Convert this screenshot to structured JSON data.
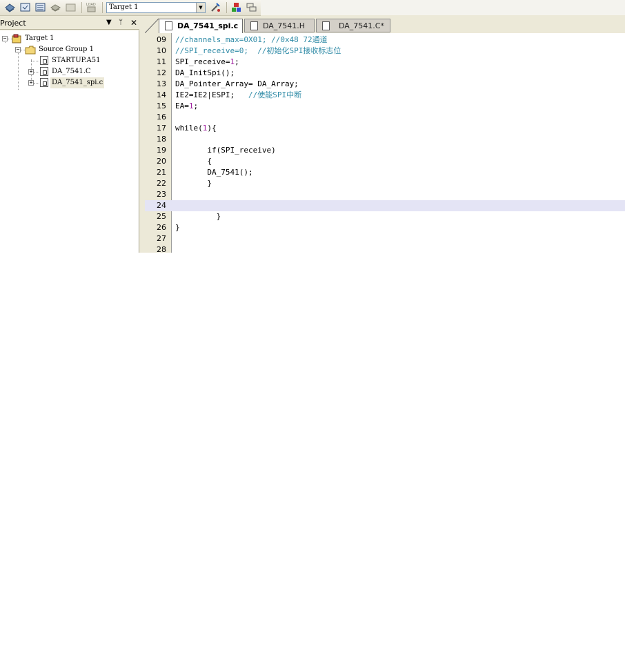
{
  "toolbar": {
    "target_value": "Target 1",
    "icons": [
      "build-icon",
      "translate-icon",
      "rebuild-icon",
      "batch-build-icon",
      "stop-build-icon",
      "load-icon",
      "target-options-icon",
      "manage-components-icon",
      "select-packs-icon"
    ]
  },
  "project_panel": {
    "title": "Project",
    "tree": {
      "root": "Target 1",
      "group": "Source Group 1",
      "files": [
        "STARTUP.A51",
        "DA_7541.C",
        "DA_7541_spi.c"
      ]
    }
  },
  "tabs": [
    {
      "label": "DA_7541_spi.c",
      "active": true
    },
    {
      "label": "DA_7541.H",
      "active": false
    },
    {
      "label": "DA_7541.C*",
      "active": false
    }
  ],
  "editor": {
    "highlighted_line": "24",
    "lines": [
      {
        "n": "09",
        "parts": [
          {
            "t": "//channels_max=0X01; //0x48 72通道",
            "c": "cmt"
          }
        ]
      },
      {
        "n": "10",
        "parts": [
          {
            "t": "//SPI_receive=0;  //初始化SPI接收标志位",
            "c": "cmt"
          }
        ]
      },
      {
        "n": "11",
        "parts": [
          {
            "t": "SPI_receive=",
            "c": ""
          },
          {
            "t": "1",
            "c": "num"
          },
          {
            "t": ";",
            "c": ""
          }
        ]
      },
      {
        "n": "12",
        "parts": [
          {
            "t": "DA_InitSpi();",
            "c": ""
          }
        ]
      },
      {
        "n": "13",
        "parts": [
          {
            "t": "DA_Pointer_Array= DA_Array;",
            "c": ""
          }
        ]
      },
      {
        "n": "14",
        "parts": [
          {
            "t": "IE2=IE2|ESPI;   ",
            "c": ""
          },
          {
            "t": "//使能SPI中断",
            "c": "cmt"
          }
        ]
      },
      {
        "n": "15",
        "parts": [
          {
            "t": "EA=",
            "c": ""
          },
          {
            "t": "1",
            "c": "num"
          },
          {
            "t": ";",
            "c": ""
          }
        ]
      },
      {
        "n": "16",
        "parts": []
      },
      {
        "n": "17",
        "parts": [
          {
            "t": "while(",
            "c": ""
          },
          {
            "t": "1",
            "c": "num"
          },
          {
            "t": "){",
            "c": ""
          }
        ]
      },
      {
        "n": "18",
        "parts": []
      },
      {
        "n": "19",
        "parts": [
          {
            "t": "       if(SPI_receive)",
            "c": ""
          }
        ]
      },
      {
        "n": "20",
        "parts": [
          {
            "t": "       {",
            "c": ""
          }
        ]
      },
      {
        "n": "21",
        "parts": [
          {
            "t": "       DA_7541();",
            "c": ""
          }
        ]
      },
      {
        "n": "22",
        "parts": [
          {
            "t": "       }",
            "c": ""
          }
        ]
      },
      {
        "n": "23",
        "parts": []
      },
      {
        "n": "24",
        "parts": []
      },
      {
        "n": "25",
        "parts": [
          {
            "t": "         }",
            "c": ""
          }
        ]
      },
      {
        "n": "26",
        "parts": [
          {
            "t": "}",
            "c": ""
          }
        ]
      },
      {
        "n": "27",
        "parts": []
      },
      {
        "n": "28",
        "parts": []
      }
    ]
  }
}
